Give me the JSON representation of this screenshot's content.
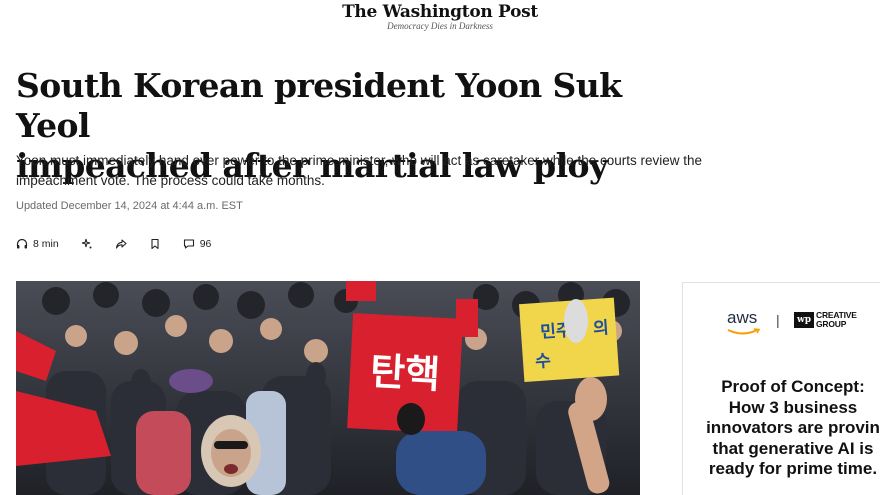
{
  "masthead": {
    "title": "The Washington Post",
    "tagline": "Democracy Dies in Darkness"
  },
  "article": {
    "headline_line1": "South Korean president Yoon Suk Yeol",
    "headline_line2": "impeached after martial law ploy",
    "dek_line1": "Yoon must immediately hand over power to the prime minister, who will act as caretaker while the courts review the",
    "dek_line2": "impeachment vote. The process could take months.",
    "timestamp": "Updated December 14, 2024 at 4:44 a.m. EST"
  },
  "toolbar": {
    "listen": {
      "icon": "headphones-icon",
      "label": "8 min"
    },
    "summary": {
      "icon": "sparkle-icon"
    },
    "share": {
      "icon": "share-icon"
    },
    "save": {
      "icon": "bookmark-icon"
    },
    "comments": {
      "icon": "comment-icon",
      "count": "96"
    }
  },
  "photo": {
    "sign_text": "탄핵",
    "yellow_sign_line1": "민주",
    "yellow_sign_line1_right": "의",
    "yellow_sign_line2": "수"
  },
  "ad": {
    "sponsor": "aws",
    "separator": "|",
    "partner_mark": "wp",
    "partner_name_line1": "CREATIVE",
    "partner_name_line2": "GROUP",
    "copy_line1": "Proof of Concept:",
    "copy_line2": "How 3 business",
    "copy_line3": "innovators are provin",
    "copy_line4": "that generative AI is",
    "copy_line5": "ready for prime time."
  },
  "colors": {
    "sign_red": "#d8202e",
    "sign_yellow": "#f1d54a",
    "crowd_dark": "#2a2c33",
    "text_dark": "#111111",
    "aws_orange": "#ff9900"
  }
}
